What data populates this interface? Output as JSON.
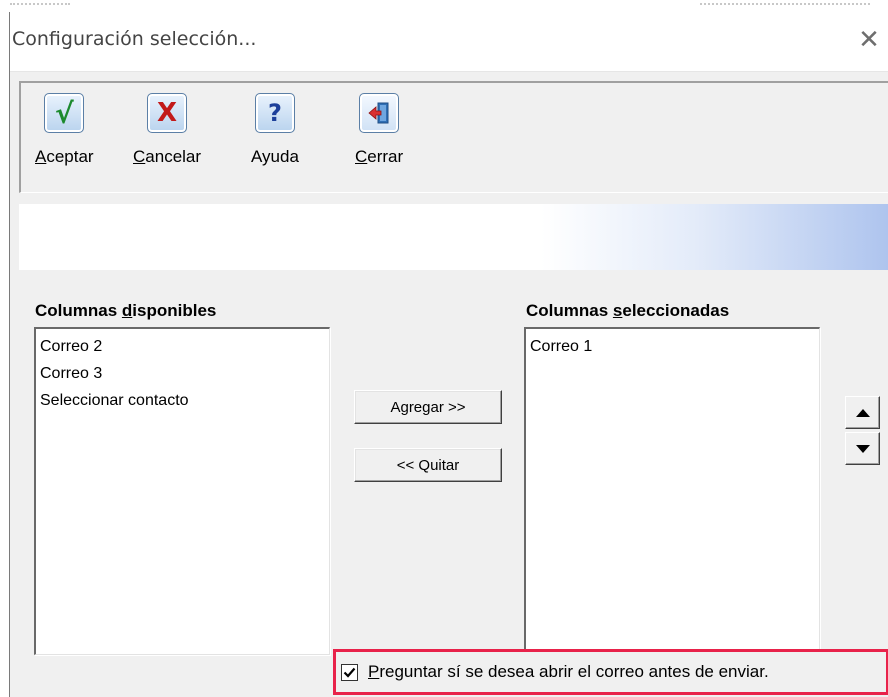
{
  "window": {
    "title": "Configuración selección...",
    "close_glyph": "✕"
  },
  "toolbar": {
    "buttons": [
      {
        "id": "accept",
        "icon": "check-icon",
        "glyph": "√",
        "mnemonic": "A",
        "rest": "ceptar"
      },
      {
        "id": "cancel",
        "icon": "x-icon",
        "glyph": "X",
        "mnemonic": "C",
        "rest": "ancelar"
      },
      {
        "id": "help",
        "icon": "question-icon",
        "glyph": "?",
        "mnemonic": "",
        "rest": "Ayuda"
      },
      {
        "id": "close",
        "icon": "door-exit-icon",
        "glyph": "",
        "mnemonic": "C",
        "rest": "errar"
      }
    ]
  },
  "available": {
    "label_before": "Columnas ",
    "label_mnemonic": "d",
    "label_after": "isponibles",
    "items": [
      "Correo 2",
      "Correo 3",
      "Seleccionar contacto"
    ]
  },
  "selected": {
    "label_before": "Columnas ",
    "label_mnemonic": "s",
    "label_after": "eleccionadas",
    "items": [
      "Correo 1"
    ]
  },
  "actions": {
    "add": "Agregar >>",
    "remove": "<< Quitar"
  },
  "option": {
    "checked": true,
    "mnemonic": "P",
    "rest": "reguntar sí se desea abrir el correo antes de enviar."
  },
  "colors": {
    "highlight_border": "#e8224a",
    "dialog_bg": "#f0f0f0"
  }
}
